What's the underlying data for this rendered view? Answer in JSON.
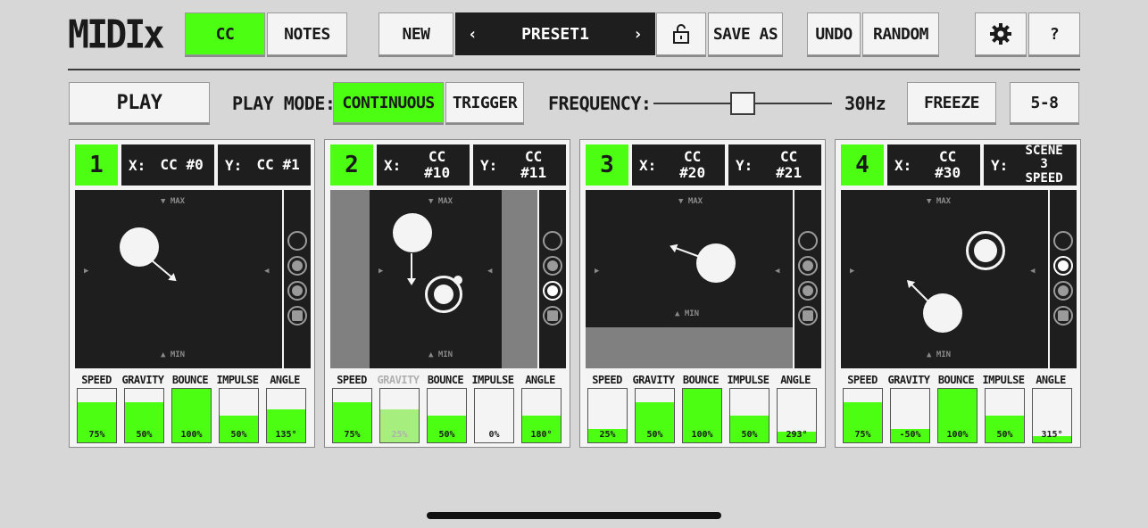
{
  "app": {
    "logo": "MIDIx"
  },
  "top": {
    "cc": "CC",
    "notes": "NOTES",
    "new": "NEW",
    "preset_prev": "‹",
    "preset_name": "PRESET1",
    "preset_next": "›",
    "lock_icon": "unlock-icon",
    "save_as": "SAVE AS",
    "undo": "UNDO",
    "random": "RANDOM",
    "settings_icon": "gear-icon",
    "help": "?"
  },
  "controls": {
    "play": "PLAY",
    "play_mode_label": "PLAY MODE:",
    "continuous": "CONTINUOUS",
    "trigger": "TRIGGER",
    "frequency_label": "FREQUENCY:",
    "frequency_value": "30Hz",
    "frequency_level": 0.5,
    "freeze": "FREEZE",
    "range": "5-8"
  },
  "pad_labels": {
    "max": "MAX",
    "min": "MIN"
  },
  "knob_labels": [
    "SPEED",
    "GRAVITY",
    "BOUNCE",
    "IMPULSE",
    "ANGLE"
  ],
  "colors": {
    "accent": "#4cff12",
    "dark": "#1e1e1e",
    "panel": "#f4f4f4"
  },
  "panels": [
    {
      "num": "1",
      "x_label": "X:",
      "x_value": "CC #0",
      "y_label": "Y:",
      "y_value": "CC #1",
      "knobs": [
        {
          "value": "75%",
          "level": 0.75
        },
        {
          "value": "50%",
          "level": 0.75
        },
        {
          "value": "100%",
          "level": 1.0
        },
        {
          "value": "50%",
          "level": 0.5
        },
        {
          "value": "135°",
          "level": 0.62
        }
      ]
    },
    {
      "num": "2",
      "x_label": "X:",
      "x_value": "CC #10",
      "y_label": "Y:",
      "y_value": "CC #11",
      "knobs": [
        {
          "value": "75%",
          "level": 0.75
        },
        {
          "value": "25%",
          "level": 0.62
        },
        {
          "value": "50%",
          "level": 0.5
        },
        {
          "value": "0%",
          "level": 0.0
        },
        {
          "value": "180°",
          "level": 0.5
        }
      ]
    },
    {
      "num": "3",
      "x_label": "X:",
      "x_value": "CC #20",
      "y_label": "Y:",
      "y_value": "CC #21",
      "knobs": [
        {
          "value": "25%",
          "level": 0.25
        },
        {
          "value": "50%",
          "level": 0.75
        },
        {
          "value": "100%",
          "level": 1.0
        },
        {
          "value": "50%",
          "level": 0.5
        },
        {
          "value": "293°",
          "level": 0.2
        }
      ]
    },
    {
      "num": "4",
      "x_label": "X:",
      "x_value": "CC #30",
      "y_label": "Y:",
      "y_value": "SCENE 3 SPEED",
      "knobs": [
        {
          "value": "75%",
          "level": 0.75
        },
        {
          "value": "-50%",
          "level": 0.25
        },
        {
          "value": "100%",
          "level": 1.0
        },
        {
          "value": "50%",
          "level": 0.5
        },
        {
          "value": "315°",
          "level": 0.12
        }
      ]
    }
  ]
}
